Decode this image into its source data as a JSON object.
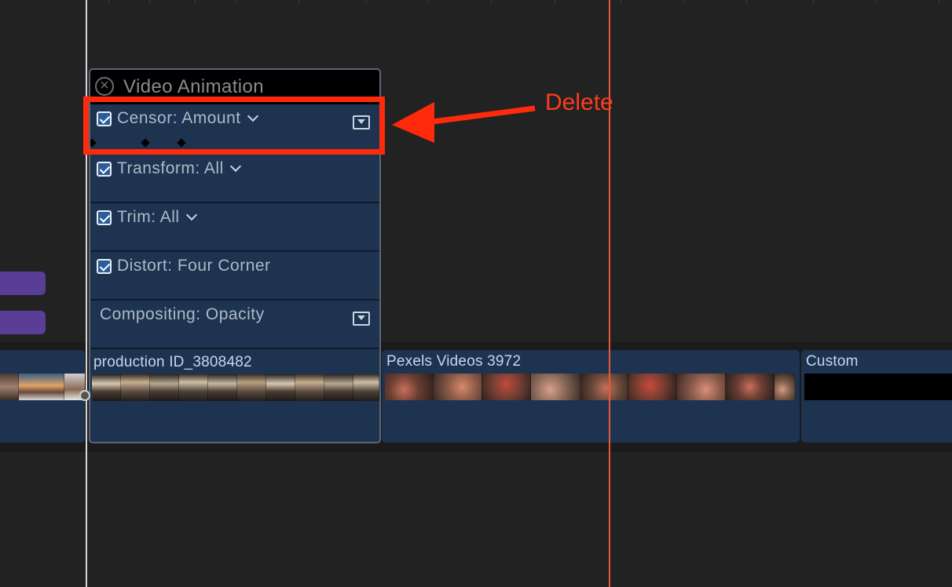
{
  "animation_panel": {
    "title": "Video Animation",
    "rows": [
      {
        "label": "Censor: Amount",
        "checked": true
      },
      {
        "label": "Transform: All",
        "checked": true
      },
      {
        "label": "Trim: All",
        "checked": true
      },
      {
        "label": "Distort: Four Corner",
        "checked": true
      },
      {
        "label": "Compositing: Opacity",
        "checked": false
      }
    ]
  },
  "clips": [
    {
      "title": "production ID_3808482"
    },
    {
      "title": "Pexels Videos 3972"
    },
    {
      "title": "Custom"
    }
  ],
  "annotation": {
    "label": "Delete",
    "color": "#ff2a0c"
  },
  "colors": {
    "clip_blue": "#1e3350",
    "playhead_orange": "#e8593c",
    "purple_clip": "#5a3d96"
  },
  "icons": {
    "close": "circle-x-icon",
    "checkbox": "checkbox-checked-icon",
    "chevron": "chevron-down-icon",
    "curve_editor": "curve-editor-icon"
  }
}
